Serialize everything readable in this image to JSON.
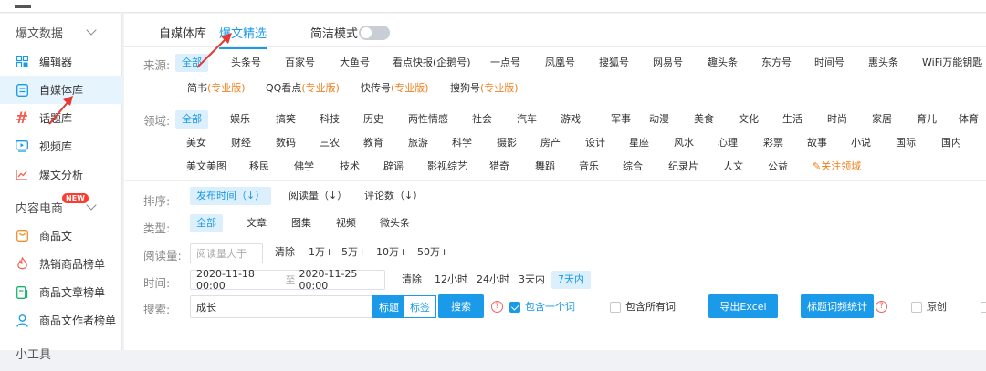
{
  "sidebar": {
    "group1": "爆文数据",
    "items1": [
      {
        "label": "编辑器",
        "icon": "grid-icon"
      },
      {
        "label": "自媒体库",
        "icon": "document-icon"
      },
      {
        "label": "话题库",
        "icon": "hashtag-icon"
      },
      {
        "label": "视频库",
        "icon": "video-icon"
      },
      {
        "label": "爆文分析",
        "icon": "chart-icon"
      }
    ],
    "group2": "内容电商",
    "group2_badge": "NEW",
    "items2": [
      {
        "label": "商品文",
        "icon": "bag-icon"
      },
      {
        "label": "热销商品榜单",
        "icon": "fire-icon"
      },
      {
        "label": "商品文章榜单",
        "icon": "list-icon"
      },
      {
        "label": "商品文作者榜单",
        "icon": "user-icon"
      }
    ],
    "group3": "小工具"
  },
  "tabs": {
    "t1": "自媒体库",
    "t2": "爆文精选",
    "simple_mode": "简洁模式"
  },
  "filters": {
    "source_label": "来源:",
    "sources_row1": [
      "全部",
      "头条号",
      "百家号",
      "大鱼号",
      "看点快报(企鹅号)",
      "一点号",
      "凤凰号",
      "搜狐号",
      "网易号",
      "趣头条",
      "东方号",
      "时间号",
      "惠头条",
      "WiFi万能钥匙"
    ],
    "sources_row2": [
      {
        "name": "简书",
        "pro": "(专业版)"
      },
      {
        "name": "QQ看点",
        "pro": "(专业版)"
      },
      {
        "name": "快传号",
        "pro": "(专业版)"
      },
      {
        "name": "搜狗号",
        "pro": "(专业版)"
      }
    ],
    "domain_label": "领域:",
    "domains_row1": [
      "全部",
      "娱乐",
      "搞笑",
      "科技",
      "历史",
      "两性情感",
      "社会",
      "汽车",
      "游戏",
      "军事",
      "动漫",
      "美食",
      "文化",
      "生活",
      "时尚",
      "家居",
      "育儿",
      "体育"
    ],
    "domains_row2": [
      "美女",
      "财经",
      "数码",
      "三农",
      "教育",
      "旅游",
      "科学",
      "摄影",
      "房产",
      "设计",
      "星座",
      "风水",
      "心理",
      "彩票",
      "故事",
      "小说",
      "国际",
      "国内"
    ],
    "domains_row3": [
      "美文美图",
      "移民",
      "佛学",
      "技术",
      "辟谣",
      "影视综艺",
      "猎奇",
      "舞蹈",
      "音乐",
      "综合",
      "纪录片",
      "人文",
      "公益"
    ],
    "follow_domain": "关注领域",
    "sort_label": "排序:",
    "sorts": [
      "发布时间（↓）",
      "阅读量（↓）",
      "评论数（↓）"
    ],
    "type_label": "类型:",
    "types": [
      "全部",
      "文章",
      "图集",
      "视频",
      "微头条"
    ],
    "reads_label": "阅读量:",
    "reads_placeholder": "阅读量大于",
    "reads_options": [
      "清除",
      "1万+",
      "5万+",
      "10万+",
      "50万+"
    ],
    "time_label": "时间:",
    "time_from": "2020-11-18 00:00",
    "time_to_sep": "至",
    "time_to": "2020-11-25 00:00",
    "time_options": [
      "清除",
      "12小时",
      "24小时",
      "3天内",
      "7天内"
    ],
    "search_label": "搜索:",
    "search_value": "成长",
    "search_mode_title": "标题",
    "search_mode_tag": "标签",
    "search_button": "搜索",
    "contains_one": "包含一个词",
    "contains_all": "包含所有词",
    "export_excel": "导出Excel",
    "word_freq": "标题词频统计",
    "original": "原创"
  },
  "colors": {
    "accent": "#1a9ae8",
    "pro": "#f07f1a",
    "arrow": "#e53935"
  }
}
